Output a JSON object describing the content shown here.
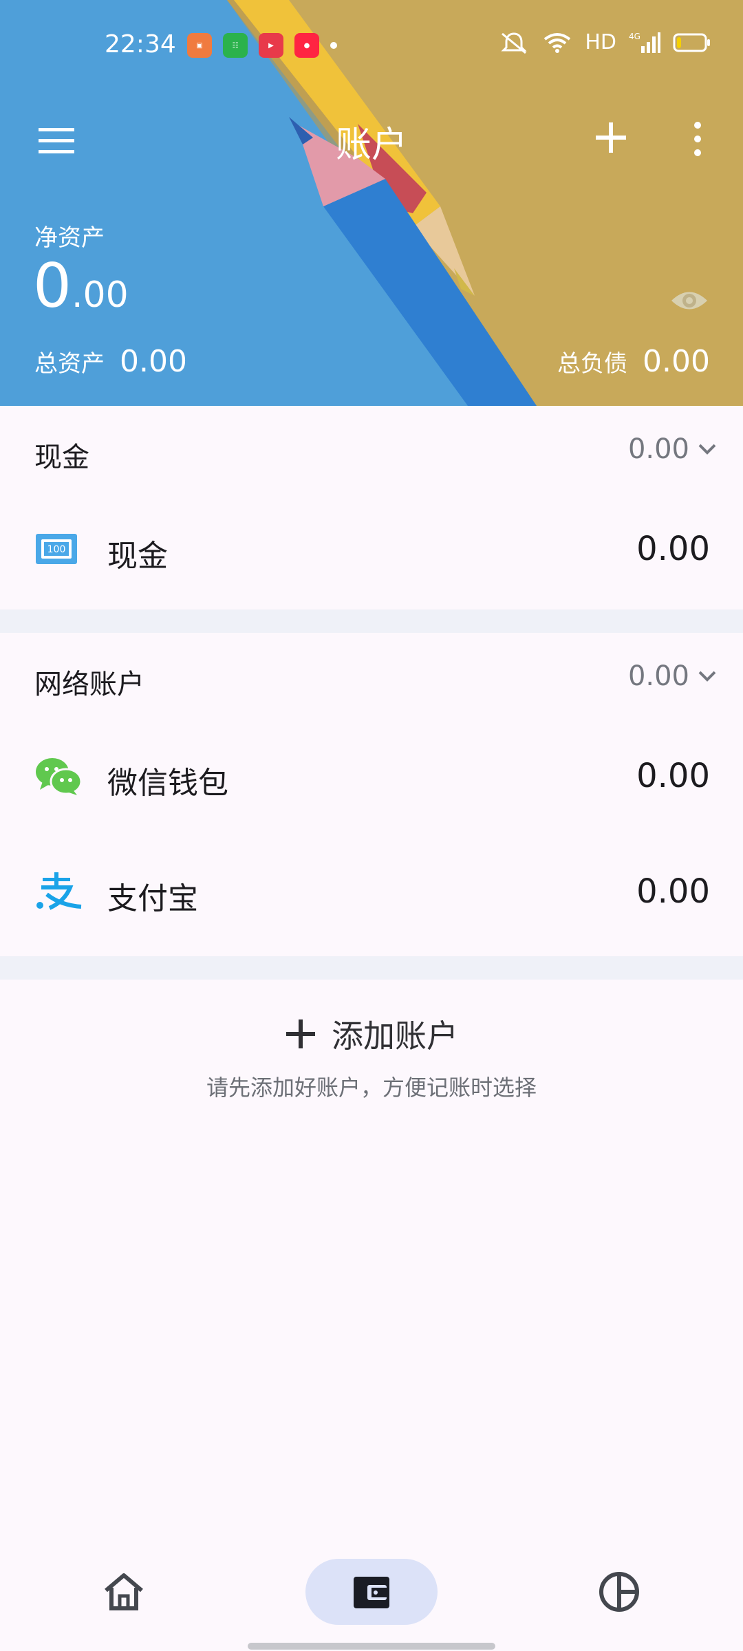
{
  "status_bar": {
    "time": "22:34",
    "app_icons": [
      "book-app-icon",
      "green-app-icon",
      "video-app-icon",
      "xiaohongshu-app-icon"
    ],
    "network": "HD",
    "signal": "4G",
    "battery_level_fraction": 0.15
  },
  "top_bar": {
    "title": "账户",
    "menu_icon": "hamburger-menu-icon",
    "add_icon": "plus-icon",
    "more_icon": "more-vertical-icon"
  },
  "summary": {
    "net_assets_label": "净资产",
    "net_assets_int": "0",
    "net_assets_dec": ".00",
    "total_assets_label": "总资产",
    "total_assets_value": "0.00",
    "total_debt_label": "总负债",
    "total_debt_value": "0.00",
    "visibility_icon": "eye-icon"
  },
  "sections": [
    {
      "title": "现金",
      "total": "0.00",
      "accounts": [
        {
          "name": "现金",
          "amount": "0.00",
          "icon": "cash-banknote-icon"
        }
      ]
    },
    {
      "title": "网络账户",
      "total": "0.00",
      "accounts": [
        {
          "name": "微信钱包",
          "amount": "0.00",
          "icon": "wechat-icon"
        },
        {
          "name": "支付宝",
          "amount": "0.00",
          "icon": "alipay-icon"
        }
      ]
    }
  ],
  "add_account": {
    "label": "添加账户",
    "hint": "请先添加好账户，方便记账时选择"
  },
  "bottom_nav": {
    "items": [
      {
        "icon": "home-icon",
        "active": false
      },
      {
        "icon": "wallet-icon",
        "active": true
      },
      {
        "icon": "pie-chart-icon",
        "active": false
      }
    ]
  },
  "colors": {
    "accent_pill": "#dce2f8",
    "page_bg": "#fdf8fd",
    "divider_bg": "#eff1f8",
    "wechat_green": "#60c84e",
    "alipay_blue": "#1aa3e8",
    "cash_blue": "#4aa8e8"
  }
}
